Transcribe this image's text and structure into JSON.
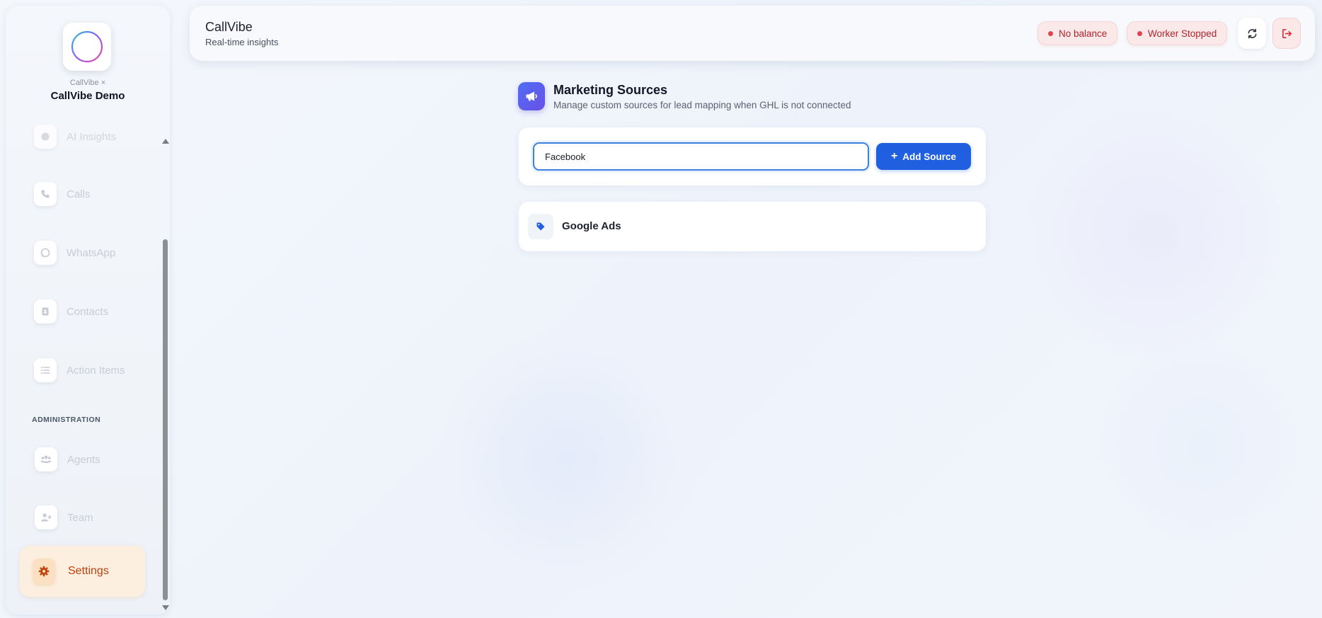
{
  "brand": {
    "sub": "CallVibe ×",
    "name": "CallVibe Demo"
  },
  "sidebar": {
    "items": [
      {
        "label": "AI Insights",
        "icon": "insights-icon"
      },
      {
        "label": "Calls",
        "icon": "phone-icon"
      },
      {
        "label": "WhatsApp",
        "icon": "whatsapp-icon"
      },
      {
        "label": "Contacts",
        "icon": "contact-book-icon"
      },
      {
        "label": "Action Items",
        "icon": "list-icon"
      }
    ],
    "admin_section": "ADMINISTRATION",
    "admin_items": [
      {
        "label": "Agents",
        "icon": "users-icon"
      },
      {
        "label": "Team",
        "icon": "user-plus-icon"
      }
    ],
    "active_item": {
      "label": "Settings",
      "icon": "gear-icon"
    }
  },
  "header": {
    "title": "CallVibe",
    "subtitle": "Real-time insights",
    "badges": [
      {
        "label": "No balance"
      },
      {
        "label": "Worker Stopped"
      }
    ]
  },
  "main": {
    "title": "Marketing Sources",
    "subtitle": "Manage custom sources for lead mapping when GHL is not connected",
    "input": {
      "value": "Facebook",
      "placeholder": ""
    },
    "add_button": "Add Source",
    "sources": [
      {
        "name": "Google Ads"
      }
    ]
  },
  "colors": {
    "accent": "#1f5fe0",
    "active_nav": "#c2410c",
    "error": "#b4232c"
  }
}
